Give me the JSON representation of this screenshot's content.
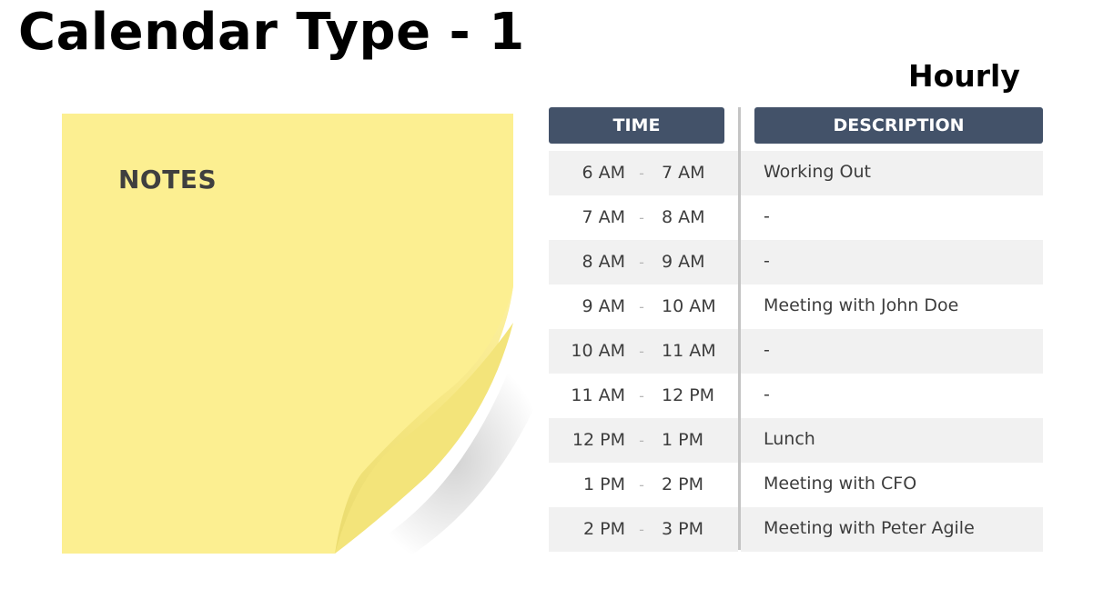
{
  "title": "Calendar Type - 1",
  "subtitle": "Hourly",
  "note": {
    "title": "NOTES",
    "color": "#fcef91"
  },
  "table": {
    "headers": {
      "time": "TIME",
      "description": "DESCRIPTION"
    },
    "header_color": "#435269",
    "rows": [
      {
        "start": "6 AM",
        "sep": "-",
        "end": "7 AM",
        "description": "Working Out"
      },
      {
        "start": "7 AM",
        "sep": "-",
        "end": "8 AM",
        "description": "-"
      },
      {
        "start": "8 AM",
        "sep": "-",
        "end": "9 AM",
        "description": "-"
      },
      {
        "start": "9 AM",
        "sep": "-",
        "end": "10 AM",
        "description": "Meeting with John Doe"
      },
      {
        "start": "10 AM",
        "sep": "-",
        "end": "11 AM",
        "description": "-"
      },
      {
        "start": "11 AM",
        "sep": "-",
        "end": "12 PM",
        "description": "-"
      },
      {
        "start": "12 PM",
        "sep": "-",
        "end": "1 PM",
        "description": "Lunch"
      },
      {
        "start": "1 PM",
        "sep": "-",
        "end": "2 PM",
        "description": "Meeting with CFO"
      },
      {
        "start": "2 PM",
        "sep": "-",
        "end": "3 PM",
        "description": "Meeting with Peter Agile"
      }
    ]
  }
}
